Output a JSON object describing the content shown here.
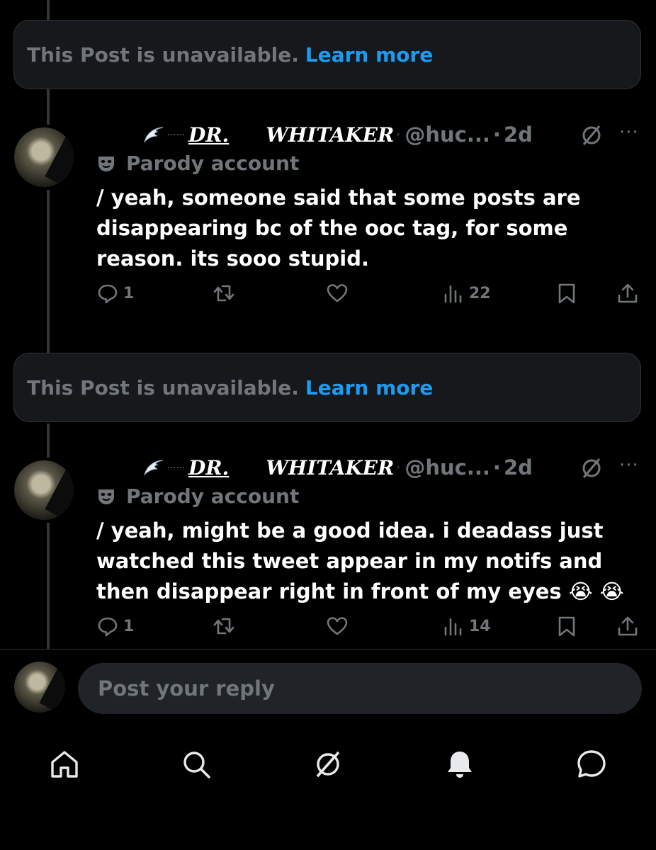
{
  "unavailable": [
    {
      "message": "This Post is unavailable.",
      "link": "Learn more"
    },
    {
      "message": "This Post is unavailable.",
      "link": "Learn more"
    }
  ],
  "posts": [
    {
      "display_name_part1": "DR.",
      "display_name_part2": "WHITAKER",
      "handle": "@huc...",
      "separator": "·",
      "time": "2d",
      "parody_label": "Parody account",
      "text": "/ yeah, someone said that some posts are disappearing bc of the ooc tag, for some reason. its sooo stupid.",
      "replies": "1",
      "views": "22"
    },
    {
      "display_name_part1": "DR.",
      "display_name_part2": "WHITAKER",
      "handle": "@huc...",
      "separator": "·",
      "time": "2d",
      "parody_label": "Parody account",
      "text": "/ yeah, might be a good idea. i deadass just watched this tweet appear in my notifs and then disappear right in front of my eyes 😭 😭",
      "replies": "1",
      "views": "14"
    }
  ],
  "reply": {
    "placeholder": "Post your reply"
  },
  "nav": {
    "items": [
      "home-icon",
      "search-icon",
      "grok-icon",
      "notifications-icon",
      "messages-icon"
    ]
  },
  "colors": {
    "background": "#000000",
    "accent": "#1d9bf0",
    "muted": "#71767b"
  }
}
